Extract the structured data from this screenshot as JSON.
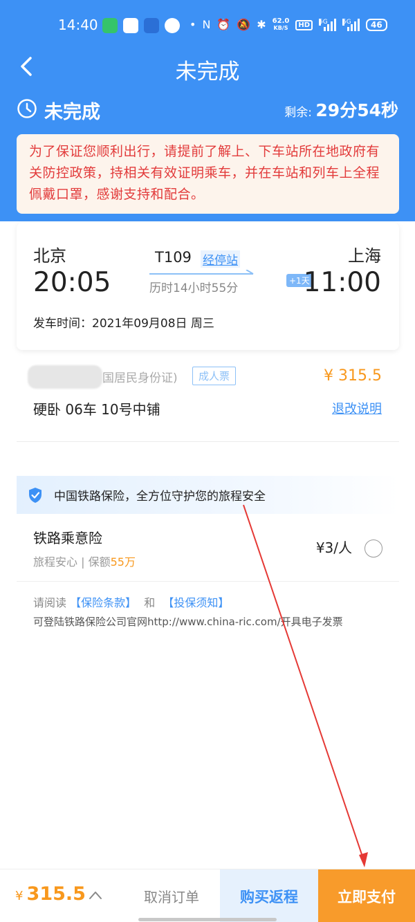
{
  "status_bar": {
    "time": "14:40",
    "net_speed_value": "62.0",
    "net_speed_unit": "KB/S",
    "hd_label": "HD",
    "signal1_label": "5G",
    "signal2_label": "5G",
    "battery": "46"
  },
  "nav": {
    "title": "未完成"
  },
  "order_status": {
    "label": "未完成",
    "remaining_label": "剩余: ",
    "remaining_value": "29分54秒"
  },
  "notice": {
    "text": "为了保证您顺利出行，请提前了解上、下车站所在地政府有关防控政策，持相关有效证明乘车，并在车站和列车上全程佩戴口罩，感谢支持和配合。"
  },
  "train": {
    "from_city": "北京",
    "from_time": "20:05",
    "to_city": "上海",
    "to_time": "11:00",
    "train_no": "T109",
    "stops_link": "经停站",
    "duration": "历时14小时55分",
    "plus_day": "+1天",
    "depart_label": "发车时间：",
    "depart_value": "2021年09月08日 周三"
  },
  "passenger": {
    "id_type": "国居民身份证)",
    "ticket_type": "成人票",
    "price": "¥ 315.5",
    "seat": "硬卧 06车 10号中铺",
    "refund_link": "退改说明"
  },
  "insurance": {
    "banner": "中国铁路保险，全方位守护您的旅程安全",
    "name": "铁路乘意险",
    "desc_prefix": "旅程安心 | 保额",
    "desc_amount": "55万",
    "price": "¥3/人",
    "read_prefix": "请阅读",
    "terms_link": "【保险条款】",
    "and": "和",
    "notice_link": "【投保须知】",
    "site_text": "可登陆铁路保险公司官网http://www.china-ric.com/开具电子发票"
  },
  "bottom": {
    "currency": "¥",
    "total": "315.5",
    "cancel_label": "取消订单",
    "return_label": "购买返程",
    "pay_label": "立即支付"
  },
  "colors": {
    "brand_blue": "#3d91f5",
    "accent_orange": "#f89b2b",
    "notice_red": "#e23b3b",
    "annotation_red": "#e53935"
  }
}
